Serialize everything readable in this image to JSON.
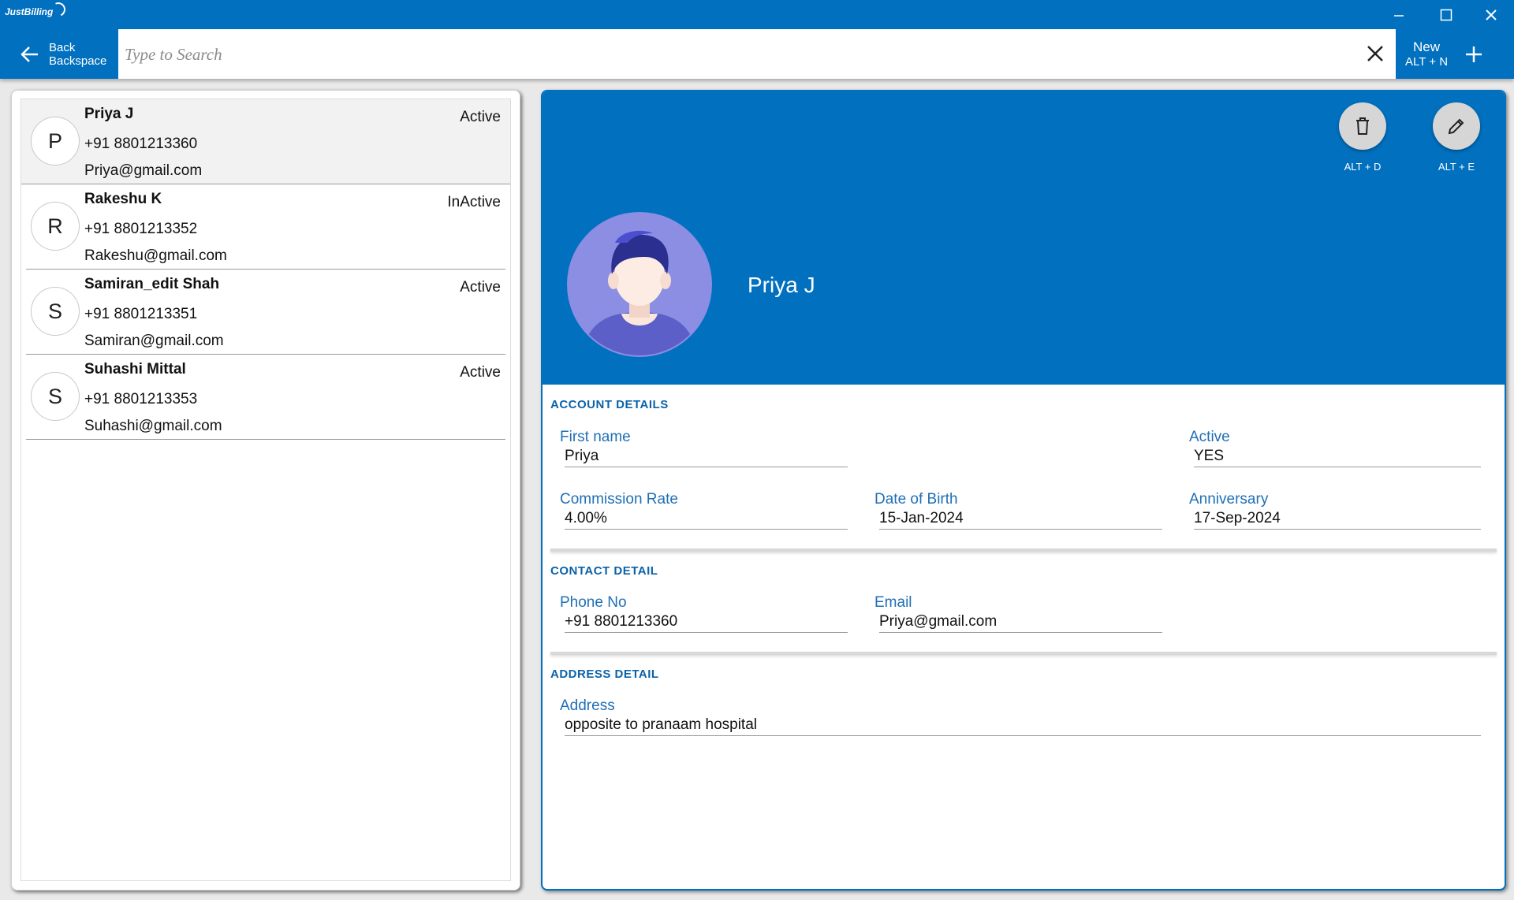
{
  "app": {
    "logo_text": "JustBilling"
  },
  "toolbar": {
    "back_label": "Back",
    "back_shortcut": "Backspace",
    "search_placeholder": "Type to Search",
    "new_label": "New",
    "new_shortcut": "ALT + N"
  },
  "customers": [
    {
      "initial": "P",
      "name": "Priya J",
      "phone": "+91 8801213360",
      "email": "Priya@gmail.com",
      "status": "Active"
    },
    {
      "initial": "R",
      "name": "Rakeshu K",
      "phone": "+91 8801213352",
      "email": "Rakeshu@gmail.com",
      "status": "InActive"
    },
    {
      "initial": "S",
      "name": "Samiran_edit Shah",
      "phone": "+91 8801213351",
      "email": "Samiran@gmail.com",
      "status": "Active"
    },
    {
      "initial": "S",
      "name": "Suhashi Mittal",
      "phone": "+91 8801213353",
      "email": "Suhashi@gmail.com",
      "status": "Active"
    }
  ],
  "detail": {
    "name": "Priya J",
    "delete_shortcut": "ALT + D",
    "edit_shortcut": "ALT + E",
    "account_title": "ACCOUNT DETAILS",
    "first_name_label": "First name",
    "first_name": "Priya",
    "active_label": "Active",
    "active": "YES",
    "commission_label": "Commission Rate",
    "commission": "4.00%",
    "dob_label": "Date of Birth",
    "dob": "15-Jan-2024",
    "anniversary_label": "Anniversary",
    "anniversary": "17-Sep-2024",
    "contact_title": "CONTACT DETAIL",
    "phone_label": "Phone No",
    "phone": "+91 8801213360",
    "email_label": "Email",
    "email": "Priya@gmail.com",
    "address_title": "ADDRESS DETAIL",
    "address_label": "Address",
    "address": "opposite to pranaam hospital"
  },
  "colors": {
    "primary": "#0170bf",
    "label_blue": "#1f6fb5",
    "selected_row": "#f2f2f2"
  }
}
